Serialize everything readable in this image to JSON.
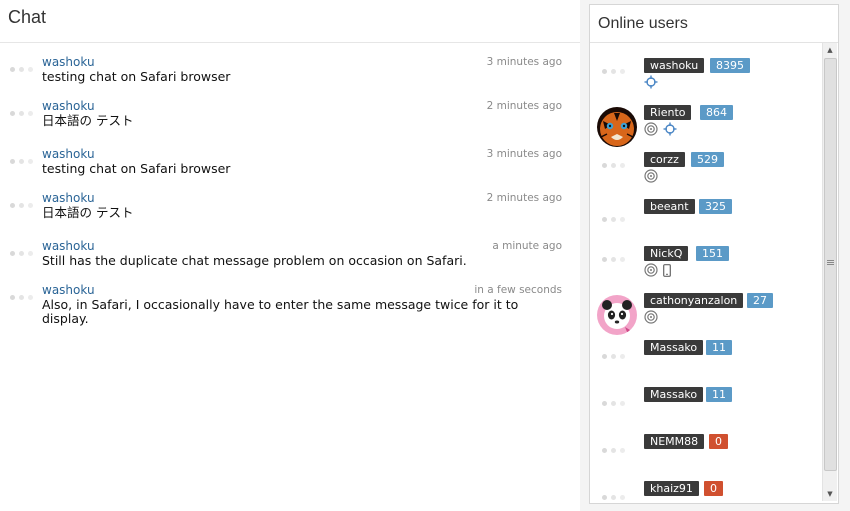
{
  "chat": {
    "title": "Chat",
    "messages": [
      {
        "author": "washoku",
        "time": "3 minutes ago",
        "text": "testing chat on Safari browser"
      },
      {
        "author": "washoku",
        "time": "2 minutes ago",
        "text": "日本語の テスト"
      },
      {
        "author": "washoku",
        "time": "3 minutes ago",
        "text": "testing chat on Safari browser"
      },
      {
        "author": "washoku",
        "time": "2 minutes ago",
        "text": "日本語の テスト"
      },
      {
        "author": "washoku",
        "time": "a minute ago",
        "text": "Still has the duplicate chat message problem on occasion on Safari."
      },
      {
        "author": "washoku",
        "time": "in a few seconds",
        "text": "Also, in Safari, I occasionally have to enter the same message twice for it to display."
      }
    ]
  },
  "online_users": {
    "title": "Online users",
    "users": [
      {
        "name": "washoku",
        "score": "8395",
        "score_color": "#5b9ac7",
        "icons": [
          "crosshair-icon"
        ]
      },
      {
        "name": "Riento",
        "score": "864",
        "score_color": "#5b9ac7",
        "icons": [
          "target-icon",
          "crosshair-icon"
        ],
        "avatar": "tiger-avatar"
      },
      {
        "name": "corzz",
        "score": "529",
        "score_color": "#5b9ac7",
        "icons": [
          "target-icon"
        ]
      },
      {
        "name": "beeant",
        "score": "325",
        "score_color": "#5b9ac7",
        "icons": []
      },
      {
        "name": "NickQ",
        "score": "151",
        "score_color": "#5b9ac7",
        "icons": [
          "target-icon",
          "mobile-icon"
        ]
      },
      {
        "name": "cathonyanzalon",
        "score": "27",
        "score_color": "#5b9ac7",
        "icons": [
          "target-icon"
        ],
        "avatar": "panda-avatar"
      },
      {
        "name": "Massako",
        "score": "11",
        "score_color": "#5b9ac7",
        "icons": []
      },
      {
        "name": "Massako",
        "score": "11",
        "score_color": "#5b9ac7",
        "icons": []
      },
      {
        "name": "NEMM88",
        "score": "0",
        "score_color": "#d0502f",
        "icons": []
      },
      {
        "name": "khaiz91",
        "score": "0",
        "score_color": "#d0502f",
        "icons": []
      }
    ]
  }
}
